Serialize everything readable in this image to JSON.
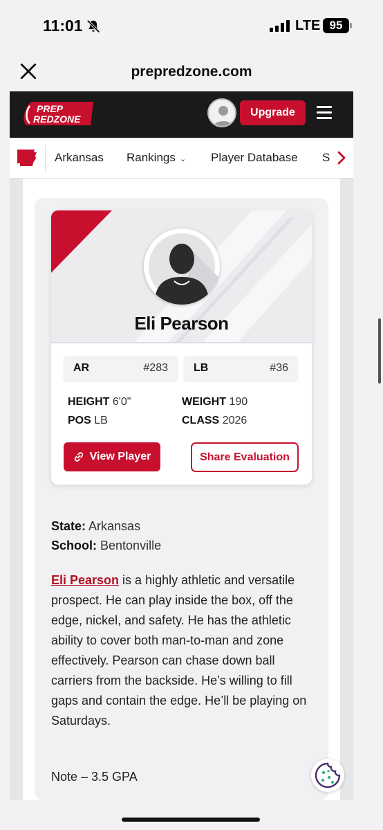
{
  "status_bar": {
    "time": "11:01",
    "network": "LTE",
    "battery": "95"
  },
  "browser": {
    "url": "prepredzone.com"
  },
  "header": {
    "logo_line1": "PREP",
    "logo_line2": "REDZONE",
    "upgrade_label": "Upgrade"
  },
  "nav": {
    "items": [
      {
        "label": "Arkansas"
      },
      {
        "label": "Rankings",
        "has_dropdown": true
      },
      {
        "label": "Player Database"
      },
      {
        "label": "S"
      }
    ]
  },
  "player": {
    "name": "Eli Pearson",
    "state_abbr": "AR",
    "state_rank": "#283",
    "position_abbr": "LB",
    "position_rank": "#36",
    "height_label": "HEIGHT",
    "height_value": "6'0\"",
    "weight_label": "WEIGHT",
    "weight_value": "190",
    "pos_label": "POS",
    "pos_value": "LB",
    "class_label": "CLASS",
    "class_value": "2026",
    "view_label": "View Player",
    "share_label": "Share Evaluation"
  },
  "details": {
    "state_label": "State:",
    "state_value": "Arkansas",
    "school_label": "School:",
    "school_value": "Bentonville"
  },
  "bio": {
    "name_link": "Eli Pearson",
    "text": " is a highly athletic and versatile prospect. He can play inside the box, off the edge, nickel, and safety. He has the athletic ability to cover both man-to-man and zone effectively. Pearson can chase down ball carriers from the backside. He’s willing to fill gaps and contain the edge. He’ll be playing on Saturdays."
  },
  "note": "Note – 3.5 GPA",
  "colors": {
    "brand_red": "#c8102e",
    "header_black": "#1a1a1a"
  }
}
